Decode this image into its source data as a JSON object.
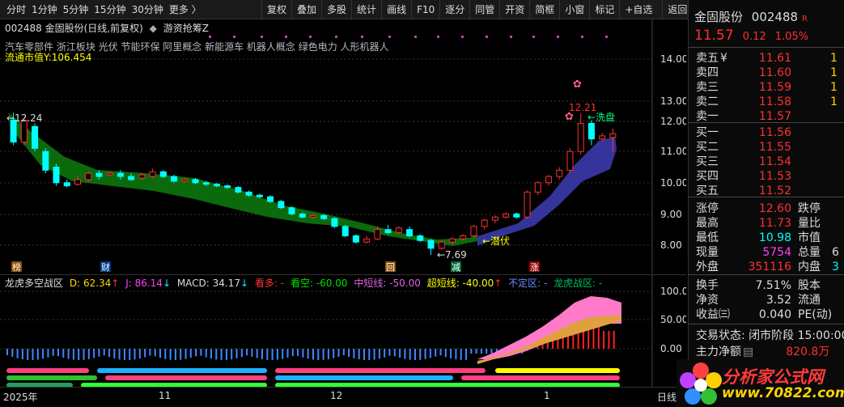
{
  "toolbar": {
    "left_items": [
      "分时",
      "1分钟",
      "5分钟",
      "15分钟",
      "30分钟",
      "更多 〉"
    ],
    "right_buttons": [
      "复权",
      "叠加",
      "多股",
      "统计",
      "画线",
      "F10",
      "逐分",
      "同管",
      "开资",
      "简框",
      "小窗",
      "标记",
      "+自选"
    ],
    "back_label": "返回"
  },
  "chart_header": {
    "code_name": "002488  金固股份(日线,前复权)",
    "arrow": "◆",
    "formula": "游资抢筹Z"
  },
  "concepts": "汽车零部件  浙江板块  光伏  节能环保  阿里概念  新能源车  机器人概念  绿色电力  人形机器人",
  "float_cap": "流通市值Y:106.454",
  "annotations": {
    "high_left": "←12.24",
    "low_label": "←7.69",
    "peak_label": "12.21",
    "wash_label": "←洗盘",
    "lurk_label": "←潜伏"
  },
  "badges": [
    "榜",
    "财",
    "回",
    "减",
    "涨"
  ],
  "indicator": {
    "name": "龙虎多空战区",
    "d": "D: 62.34",
    "d_arrow": "↑",
    "j": "J: 86.14",
    "j_arrow": "↓",
    "macd": "MACD: 34.17",
    "macd_arrow": "↓",
    "bull": "看多: -",
    "bear": "看空: -60.00",
    "mid": "中短线: -50.00",
    "super": "超短线: -40.00",
    "super_arrow": "↑",
    "unstable": "不定区: -",
    "dragon": "龙虎战区: -"
  },
  "axis": {
    "price_ticks": [
      "14.00",
      "13.00",
      "12.00",
      "11.00",
      "10.00",
      "9.00",
      "8.00"
    ],
    "ind_ticks": [
      "100.0",
      "50.00",
      "0.00"
    ],
    "date_labels": [
      "2025年",
      "11",
      "12",
      "1"
    ],
    "date_suffix": "日线"
  },
  "quote": {
    "stock_name": "金固股份",
    "stock_code": "002488",
    "rzrq": "R",
    "price": "11.57",
    "change": "0.12",
    "change_pct": "1.05%",
    "asks": [
      {
        "label": "卖五",
        "currency": "¥",
        "price": "11.61",
        "vol": "1"
      },
      {
        "label": "卖四",
        "price": "11.60",
        "vol": "1"
      },
      {
        "label": "卖三",
        "price": "11.59",
        "vol": "1"
      },
      {
        "label": "卖二",
        "price": "11.58",
        "vol": "1"
      },
      {
        "label": "卖一",
        "price": "11.57",
        "vol": ""
      }
    ],
    "bids": [
      {
        "label": "买一",
        "price": "11.56"
      },
      {
        "label": "买二",
        "price": "11.55"
      },
      {
        "label": "买三",
        "price": "11.54"
      },
      {
        "label": "买四",
        "price": "11.53"
      },
      {
        "label": "买五",
        "price": "11.52"
      }
    ],
    "stats": [
      {
        "l1": "涨停",
        "v1": "12.60",
        "l2": "跌停",
        "v2": ""
      },
      {
        "l1": "最高",
        "v1": "11.73",
        "l2": "量比",
        "v2": ""
      },
      {
        "l1": "最低",
        "v1": "10.98",
        "l2": "市值",
        "v2": ""
      },
      {
        "l1": "现量",
        "v1": "5754",
        "l2": "总量",
        "v2": "6"
      },
      {
        "l1": "外盘",
        "v1": "351116",
        "l2": "内盘",
        "v2": "3"
      }
    ],
    "fin": [
      {
        "l1": "换手",
        "v1": "7.51%",
        "l2": "股本"
      },
      {
        "l1": "净资",
        "v1": "3.52",
        "l2": "流通"
      },
      {
        "l1": "收益㈢",
        "v1": "0.040",
        "l2": "PE(动)"
      }
    ],
    "trade_state": "交易状态: 闭市阶段  15:00:00",
    "net_flow_label": "主力净额",
    "net_flow_value": "820.8万"
  },
  "logo": {
    "text": "分析家公式网",
    "url": "www.70822.com"
  },
  "colors": {
    "up": "#ff3030",
    "down": "#00ffff",
    "ribbon_green": "#006400",
    "ribbon_blue": "#3a3aa0",
    "pink": "#ff80c0",
    "orange": "#e0a040"
  }
}
